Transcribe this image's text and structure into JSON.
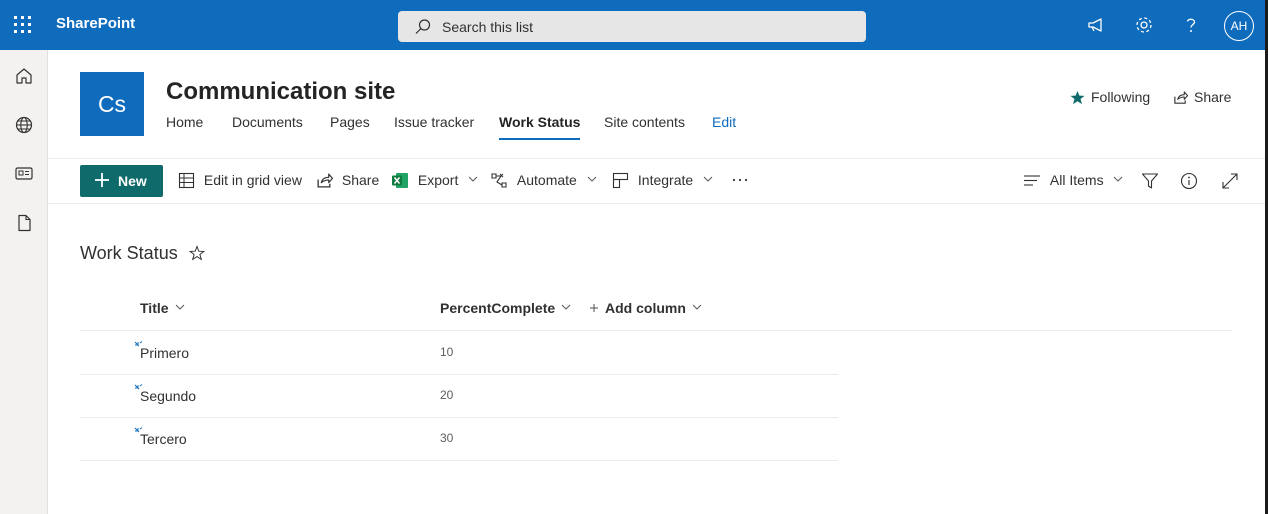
{
  "suitebar": {
    "app_name": "SharePoint",
    "search_placeholder": "Search this list",
    "avatar_initials": "AH"
  },
  "site": {
    "logo_initials": "Cs",
    "title": "Communication site",
    "nav": [
      "Home",
      "Documents",
      "Pages",
      "Issue tracker",
      "Work Status",
      "Site contents",
      "Edit"
    ],
    "active_nav": "Work Status",
    "following_label": "Following",
    "share_label": "Share"
  },
  "commandbar": {
    "new_label": "New",
    "edit_grid_label": "Edit in grid view",
    "share_label": "Share",
    "export_label": "Export",
    "automate_label": "Automate",
    "integrate_label": "Integrate",
    "view_label": "All Items"
  },
  "list": {
    "title": "Work Status",
    "columns": {
      "title": "Title",
      "percent": "PercentComplete",
      "add_column": "Add column"
    },
    "rows": [
      {
        "title": "Primero",
        "percent": "10"
      },
      {
        "title": "Segundo",
        "percent": "20"
      },
      {
        "title": "Tercero",
        "percent": "30"
      }
    ]
  },
  "colors": {
    "suitebar": "#0f6cbd",
    "new_button": "#0f6b6b",
    "accent": "#0f6cbd",
    "new_item_marker": "#0f6cbd"
  },
  "icons": [
    "waffle-icon",
    "search-icon",
    "megaphone-icon",
    "settings-icon",
    "help-icon",
    "home-icon",
    "globe-icon",
    "news-icon",
    "document-icon",
    "star-filled-icon",
    "share-icon",
    "add-icon",
    "grid-icon",
    "excel-icon",
    "automate-icon",
    "integrate-icon",
    "more-icon",
    "view-lines-icon",
    "filter-icon",
    "info-icon",
    "expand-icon",
    "star-outline-icon",
    "chevron-down-icon",
    "new-item-icon"
  ]
}
